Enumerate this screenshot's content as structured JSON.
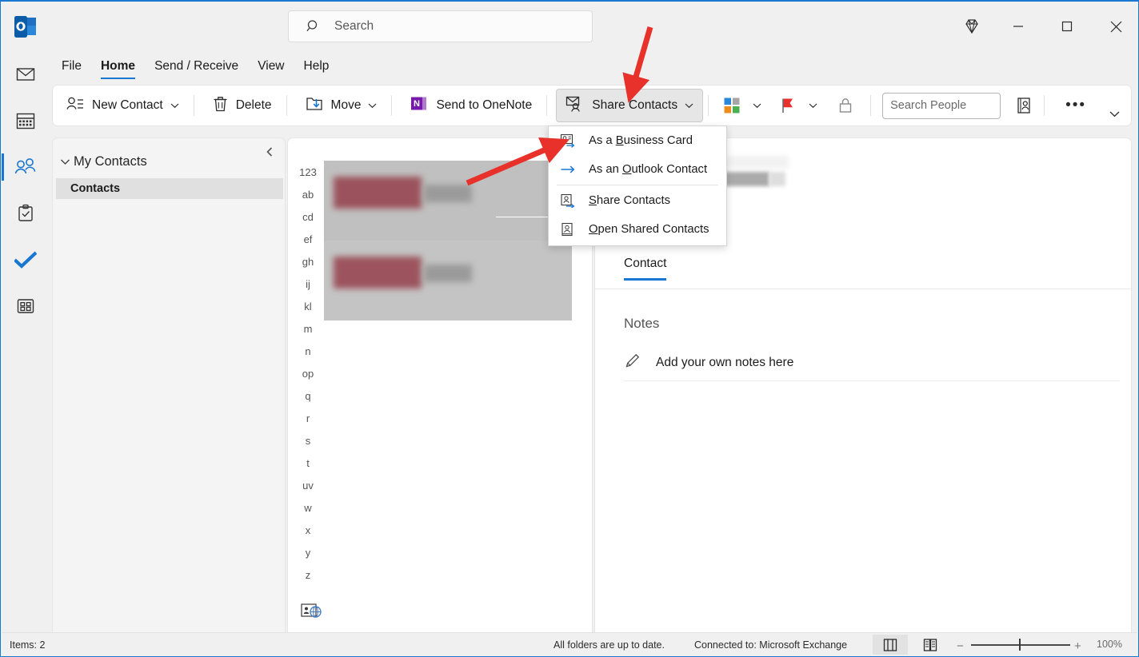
{
  "window": {
    "accent_color": "#1977d2",
    "logo_icon": "outlook-logo-icon",
    "gem_icon": "diamond-icon",
    "minimize_label": "minimize",
    "maximize_label": "maximize",
    "close_label": "close"
  },
  "search": {
    "placeholder": "Search",
    "value": "",
    "icon": "search-icon"
  },
  "ribbon_tabs": [
    {
      "label": "File",
      "active": false
    },
    {
      "label": "Home",
      "active": true
    },
    {
      "label": "Send / Receive",
      "active": false
    },
    {
      "label": "View",
      "active": false
    },
    {
      "label": "Help",
      "active": false
    }
  ],
  "ribbon": {
    "new_contact": "New Contact",
    "delete": "Delete",
    "move": "Move",
    "send_to_onenote": "Send to OneNote",
    "share_contacts": "Share Contacts",
    "categorize_icon": "categorize-icon",
    "followup_icon": "flag-icon",
    "private_icon": "lock-icon",
    "search_people_placeholder": "Search People",
    "search_people_value": "",
    "address_book_icon": "address-book-icon",
    "overflow_label": "•••",
    "expand_icon": "chevron-down-icon"
  },
  "share_menu": {
    "items": [
      {
        "label": "As a Business Card",
        "accel_before": "As a ",
        "accel": "B",
        "accel_after": "usiness Card",
        "icon": "business-card-share-icon"
      },
      {
        "label": "As an Outlook Contact",
        "accel_before": "As an ",
        "accel": "O",
        "accel_after": "utlook Contact",
        "icon": "arrow-right-icon"
      },
      {
        "label": "Share Contacts",
        "accel_before": "",
        "accel": "S",
        "accel_after": "hare Contacts",
        "icon": "contact-share-icon"
      },
      {
        "label": "Open Shared Contacts",
        "accel_before": "",
        "accel": "O",
        "accel_after": "pen Shared Contacts",
        "icon": "contact-card-icon"
      }
    ]
  },
  "nav_rail": [
    {
      "name": "mail",
      "icon": "mail-icon",
      "active": false
    },
    {
      "name": "calendar",
      "icon": "calendar-icon",
      "active": false
    },
    {
      "name": "people",
      "icon": "people-icon",
      "active": true
    },
    {
      "name": "tasks",
      "icon": "clipboard-check-icon",
      "active": false
    },
    {
      "name": "todo",
      "icon": "checkmark-icon",
      "active": false
    },
    {
      "name": "apps",
      "icon": "apps-grid-icon",
      "active": false
    }
  ],
  "folder_pane": {
    "group_label": "My Contacts",
    "group_chevron": "chevron-down-icon",
    "collapse_icon": "chevron-left-icon",
    "items": [
      {
        "label": "Contacts",
        "selected": true
      }
    ]
  },
  "contact_list": {
    "alphabet_index": [
      "123",
      "ab",
      "cd",
      "ef",
      "gh",
      "ij",
      "kl",
      "m",
      "n",
      "op",
      "q",
      "r",
      "s",
      "t",
      "uv",
      "w",
      "x",
      "y",
      "z"
    ],
    "cards": [
      {
        "redacted": true,
        "selected": true
      },
      {
        "redacted": true,
        "selected": false
      }
    ],
    "footer_icon": "contact-card-globe-icon"
  },
  "reading_pane": {
    "tabs": [
      {
        "label": "Contact",
        "active": true
      }
    ],
    "notes_heading": "Notes",
    "notes_placeholder": "Add your own notes here",
    "notes_icon": "pencil-icon"
  },
  "status_bar": {
    "items_count": "Items: 2",
    "sync_status": "All folders are up to date.",
    "connection": "Connected to: Microsoft Exchange",
    "normal_view_icon": "normal-view-icon",
    "reading_view_icon": "reading-view-icon",
    "zoom_minus": "−",
    "zoom_plus": "+",
    "zoom_level": "100%"
  },
  "annotations": {
    "arrow_color": "#e8312a",
    "arrow_1_target": "share-contacts-button",
    "arrow_2_target": "menu-item-as-a-business-card"
  }
}
